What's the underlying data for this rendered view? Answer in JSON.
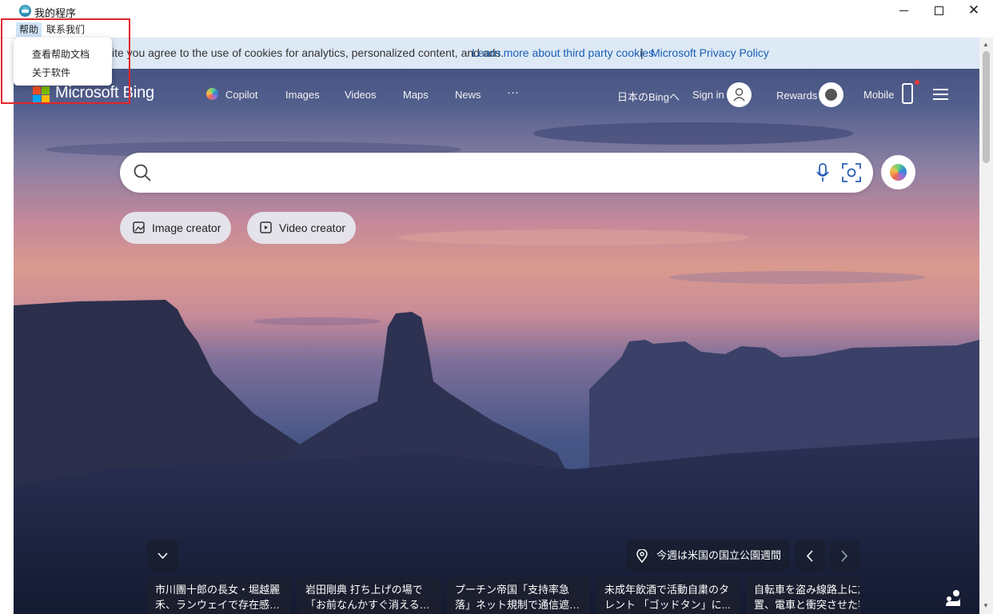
{
  "window": {
    "title": "我的程序",
    "controls": [
      "minimize",
      "maximize",
      "close"
    ]
  },
  "menubar": {
    "items": [
      {
        "label": "帮助"
      },
      {
        "label": "联系我们"
      }
    ]
  },
  "dropdown": {
    "items": [
      {
        "label": "查看帮助文档"
      },
      {
        "label": "关于软件"
      }
    ]
  },
  "cookie_bar": {
    "text": "site you agree to the use of cookies for analytics, personalized content, and ads.",
    "link1": "Learn more about third party cookies",
    "separator": "|",
    "link2": "Microsoft Privacy Policy"
  },
  "header": {
    "logo_text": "Microsoft Bing",
    "nav": [
      {
        "label": "Copilot"
      },
      {
        "label": "Images"
      },
      {
        "label": "Videos"
      },
      {
        "label": "Maps"
      },
      {
        "label": "News"
      },
      {
        "label": "···"
      }
    ],
    "region_link": "日本のBingへ",
    "sign_in": "Sign in",
    "rewards": "Rewards",
    "mobile": "Mobile"
  },
  "search": {
    "placeholder": ""
  },
  "creators": {
    "image_creator": "Image creator",
    "video_creator": "Video creator"
  },
  "location": {
    "label": "今週は米国の国立公園週間"
  },
  "news": [
    {
      "line1": "市川團十郎の長女・堀越麗",
      "line2": "禾、ランウェイで存在感放..."
    },
    {
      "line1": "岩田剛典 打ち上げの場で",
      "line2": "「お前なんかすぐ消える」..."
    },
    {
      "line1": "プーチン帝国「支持率急",
      "line2": "落」ネット規制で通信遮断..."
    },
    {
      "line1": "未成年飲酒で活動自粛のタ",
      "line2": "レント 「ゴッドタン」に..."
    },
    {
      "line1": "自転車を盗み線路上に放",
      "line2": "置、電車と衝突させた容"
    }
  ],
  "colors": {
    "accent_link": "#1a5fb4",
    "cookie_bg": "#dde9f5",
    "highlight_border": "#e0262b",
    "menu_hover": "#cfe3f7"
  }
}
